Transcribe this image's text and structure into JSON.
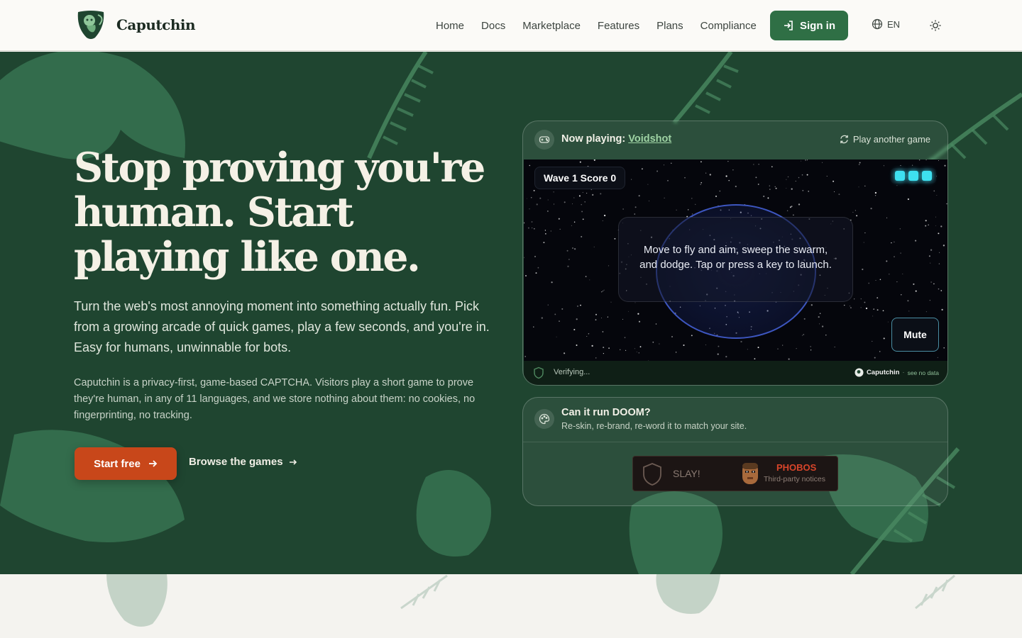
{
  "brand": {
    "name": "Caputchin"
  },
  "nav": {
    "links": [
      "Home",
      "Docs",
      "Marketplace",
      "Features",
      "Plans",
      "Compliance"
    ],
    "signin_label": "Sign in",
    "language": "EN"
  },
  "hero": {
    "headline": "Stop proving you're human. Start playing like one.",
    "lead": "Turn the web's most annoying moment into something actually fun. Pick from a growing arcade of quick games, play a few seconds, and you're in. Easy for humans, unwinnable for bots.",
    "description": "Caputchin is a privacy-first, game-based CAPTCHA. Visitors play a short game to prove they're human, in any of 11 languages, and we store nothing about them: no cookies, no fingerprinting, no tracking.",
    "start_label": "Start free",
    "browse_label": "Browse the games"
  },
  "game_card": {
    "now_playing_prefix": "Now playing:",
    "game_name": "Voidshot",
    "play_another": "Play another game",
    "wave_label": "Wave 1 Score 0",
    "lives": 3,
    "prompt": "Move to fly and aim, sweep the swarm, and dodge. Tap or press a key to launch.",
    "mute_label": "Mute",
    "status": "Verifying...",
    "footer_brand": "Caputchin",
    "footer_sep": "·",
    "footer_note": "see no data"
  },
  "doom_card": {
    "title": "Can it run DOOM?",
    "subtitle": "Re-skin, re-brand, re-word it to match your site.",
    "slay_label": "SLAY!",
    "brand_label": "PHOBOS",
    "notices_label": "Third-party notices"
  },
  "colors": {
    "hero_bg": "#1f4530",
    "accent": "#c8471a",
    "primary": "#2f6f45",
    "link": "#9fd3a4"
  }
}
